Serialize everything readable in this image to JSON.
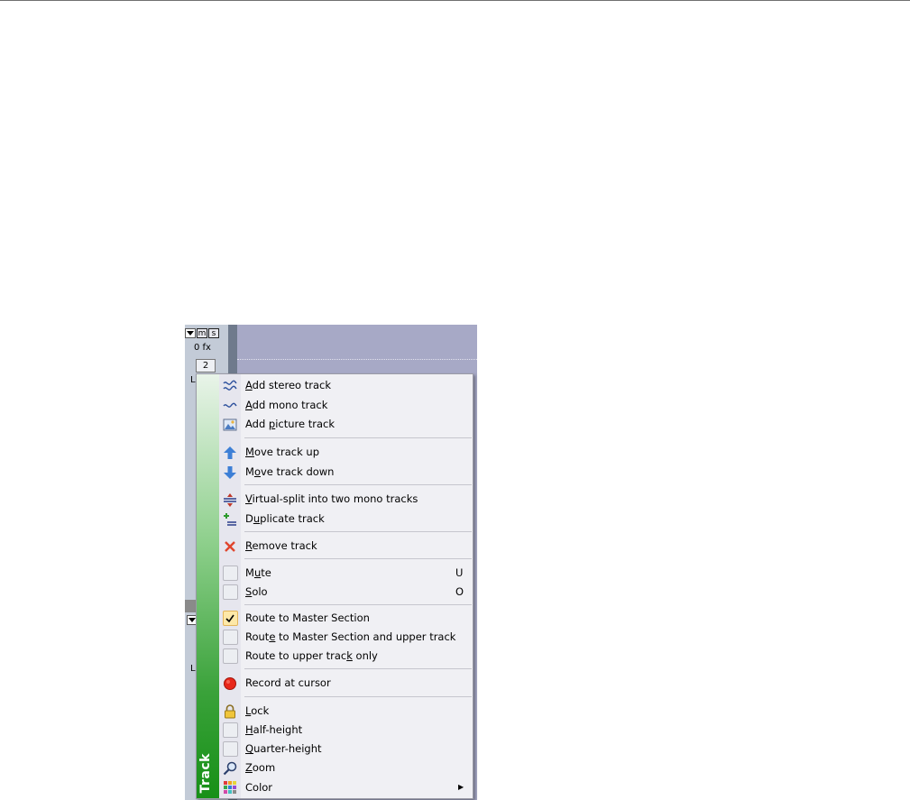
{
  "track_header": {
    "fx_label": "0 fx",
    "track_number": "2",
    "level_label": "L"
  },
  "menu": {
    "banner_title": "Track",
    "items": [
      {
        "before": "",
        "key": "A",
        "after": "dd stereo track",
        "icon": "stereo-wave-icon"
      },
      {
        "before": "",
        "key": "A",
        "after": "dd mono track",
        "icon": "mono-wave-icon"
      },
      {
        "before": "Add ",
        "key": "p",
        "after": "icture track",
        "icon": "picture-icon"
      },
      {
        "before": "",
        "key": "M",
        "after": "ove track up",
        "icon": "arrow-up-icon"
      },
      {
        "before": "M",
        "key": "o",
        "after": "ve track down",
        "icon": "arrow-down-icon"
      },
      {
        "before": "",
        "key": "V",
        "after": "irtual-split into two mono tracks",
        "icon": "split-icon"
      },
      {
        "before": "D",
        "key": "u",
        "after": "plicate track",
        "icon": "duplicate-icon"
      },
      {
        "before": "",
        "key": "R",
        "after": "emove track",
        "icon": "remove-x-icon"
      },
      {
        "before": "M",
        "key": "u",
        "after": "te",
        "icon": "checkbox",
        "shortcut": "U"
      },
      {
        "before": "",
        "key": "S",
        "after": "olo",
        "icon": "checkbox",
        "shortcut": "O"
      },
      {
        "before": "Route to Master Section",
        "key": "",
        "after": "",
        "icon": "checkbox-checked"
      },
      {
        "before": "Rout",
        "key": "e",
        "after": " to Master Section and upper track",
        "icon": "checkbox"
      },
      {
        "before": "Route to upper trac",
        "key": "k",
        "after": " only",
        "icon": "checkbox"
      },
      {
        "before": "Record at cursor",
        "key": "",
        "after": "",
        "icon": "record-icon"
      },
      {
        "before": "",
        "key": "L",
        "after": "ock",
        "icon": "lock-icon"
      },
      {
        "before": "",
        "key": "H",
        "after": "alf-height",
        "icon": "checkbox"
      },
      {
        "before": "",
        "key": "Q",
        "after": "uarter-height",
        "icon": "checkbox"
      },
      {
        "before": "",
        "key": "Z",
        "after": "oom",
        "icon": "zoom-icon"
      },
      {
        "before": "Color",
        "key": "",
        "after": "",
        "icon": "color-grid-icon",
        "submenu": true
      }
    ]
  }
}
